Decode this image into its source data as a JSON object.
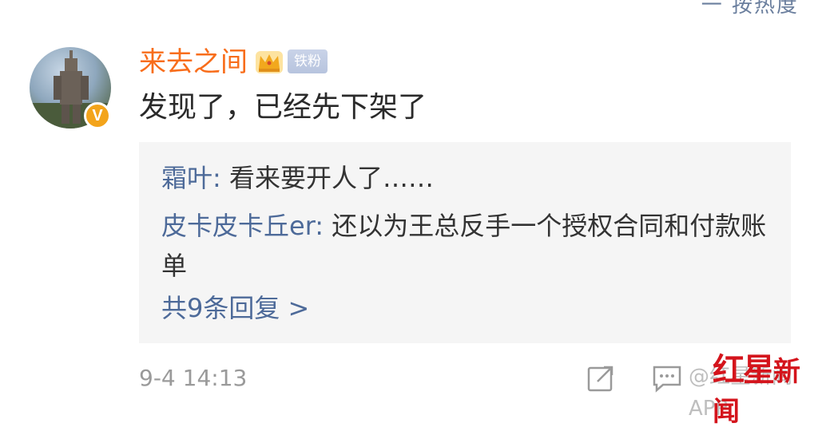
{
  "header": {
    "top_strip": "一 按热度"
  },
  "post": {
    "username": "来去之间",
    "badge_label": "铁粉",
    "verified_letter": "V",
    "text": "发现了，已经先下架了",
    "timestamp": "9-4 14:13"
  },
  "replies": [
    {
      "author": "霜叶",
      "separator": ": ",
      "text": "看来要开人了……"
    },
    {
      "author": "皮卡皮卡丘er",
      "separator": ": ",
      "text": "还以为王总反手一个授权合同和付款账单"
    }
  ],
  "more_replies": "共9条回复 >",
  "footer": {
    "icons": [
      "share-icon",
      "comment-icon"
    ],
    "watermark": "@红星新闻APP",
    "logo_text": "红星",
    "logo_text_2": "新闻"
  },
  "colors": {
    "username": "#f86d1b",
    "link": "#4d6a99",
    "reply_box_bg": "#f5f5f5",
    "logo_red": "#d4141c",
    "verified_badge": "#f3a41b"
  }
}
